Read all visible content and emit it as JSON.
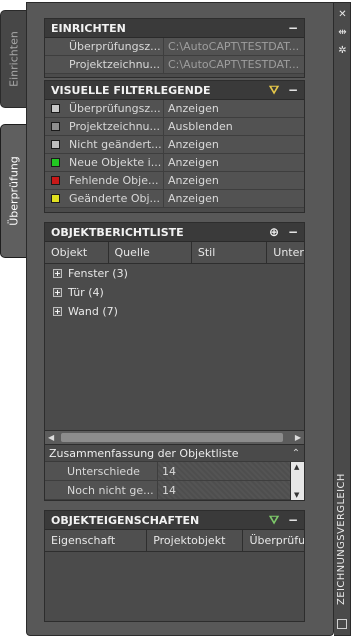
{
  "tabs": {
    "setup": "Einrichten",
    "review": "Überprüfung"
  },
  "strip": {
    "title": "ZEICHNUNGSVERGLEICH"
  },
  "setup": {
    "title": "EINRICHTEN",
    "rows": [
      {
        "label": "Überprüfungsz...",
        "value": "C:\\AutoCAPT\\TESTDAT..."
      },
      {
        "label": "Projektzeichnu...",
        "value": "C:\\AutoCAPT\\TESTDAT..."
      }
    ]
  },
  "filter": {
    "title": "VISUELLE FILTERLEGENDE",
    "rows": [
      {
        "label": "Überprüfungsz...",
        "value": "Anzeigen",
        "color": "#c8c8c8"
      },
      {
        "label": "Projektzeichnu...",
        "value": "Ausblenden",
        "color": "#8f8f8f"
      },
      {
        "label": "Nicht geändert...",
        "value": "Anzeigen",
        "color": "#bdbdbd"
      },
      {
        "label": "Neue Objekte i...",
        "value": "Anzeigen",
        "color": "#22c722"
      },
      {
        "label": "Fehlende Obje...",
        "value": "Anzeigen",
        "color": "#c81818"
      },
      {
        "label": "Geänderte Obj...",
        "value": "Anzeigen",
        "color": "#e0e020"
      }
    ]
  },
  "objects": {
    "title": "OBJEKTBERICHTLISTE",
    "columns": [
      "Objekt",
      "Quelle",
      "Stil",
      "Unter"
    ],
    "items": [
      "Fenster (3)",
      "Tür (4)",
      "Wand (7)"
    ]
  },
  "summary": {
    "title": "Zusammenfassung der Objektliste",
    "rows": [
      {
        "label": "Unterschiede",
        "value": "14"
      },
      {
        "label": "Noch nicht ge...",
        "value": "14"
      }
    ]
  },
  "properties": {
    "title": "OBJEKTEIGENSCHAFTEN",
    "columns": [
      "Eigenschaft",
      "Projektobjekt",
      "Überprüfu"
    ]
  }
}
